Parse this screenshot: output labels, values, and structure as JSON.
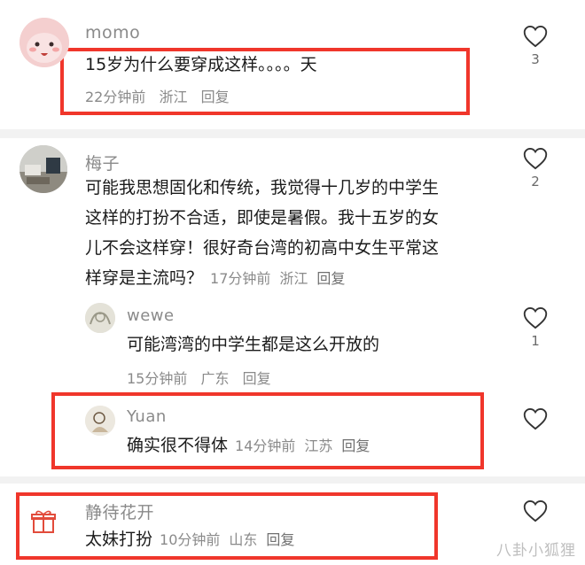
{
  "comments": [
    {
      "username": "momo",
      "text": "15岁为什么要穿成这样。。。。天",
      "time": "22分钟前",
      "location": "浙江",
      "reply_label": "回复",
      "likes": "3",
      "avatar": "pink-character-avatar"
    },
    {
      "username": "梅子",
      "text": "可能我思想固化和传统，我觉得十几岁的中学生这样的打扮不合适，即使是暑假。我十五岁的女儿不会这样穿！很好奇台湾的初高中女生平常这样穿是主流吗？",
      "text_lines": [
        "可能我思想固化和传统，我觉得十几岁的中学生",
        "这样的打扮不合适，即使是暑假。我十五岁的女",
        "儿不会这样穿！很好奇台湾的初高中女生平常这",
        "样穿是主流吗？"
      ],
      "time": "17分钟前",
      "location": "浙江",
      "reply_label": "回复",
      "likes": "2",
      "avatar": "desk-photo-avatar"
    },
    {
      "username": "wewe",
      "text": "可能湾湾的中学生都是这么开放的",
      "time": "15分钟前",
      "location": "广东",
      "reply_label": "回复",
      "likes": "1",
      "avatar": "sketch-avatar"
    },
    {
      "username": "Yuan",
      "text": "确实很不得体",
      "time": "14分钟前",
      "location": "江苏",
      "reply_label": "回复",
      "likes": "",
      "avatar": "drawing-avatar"
    },
    {
      "username": "静待花开",
      "text": "太妹打扮",
      "time": "10分钟前",
      "location": "山东",
      "reply_label": "回复",
      "likes": "",
      "avatar": "gift-icon"
    }
  ],
  "watermark": "八卦小狐狸",
  "colors": {
    "highlight": "#f0362b",
    "meta": "#8a8a8a",
    "text": "#1b1b1b"
  }
}
